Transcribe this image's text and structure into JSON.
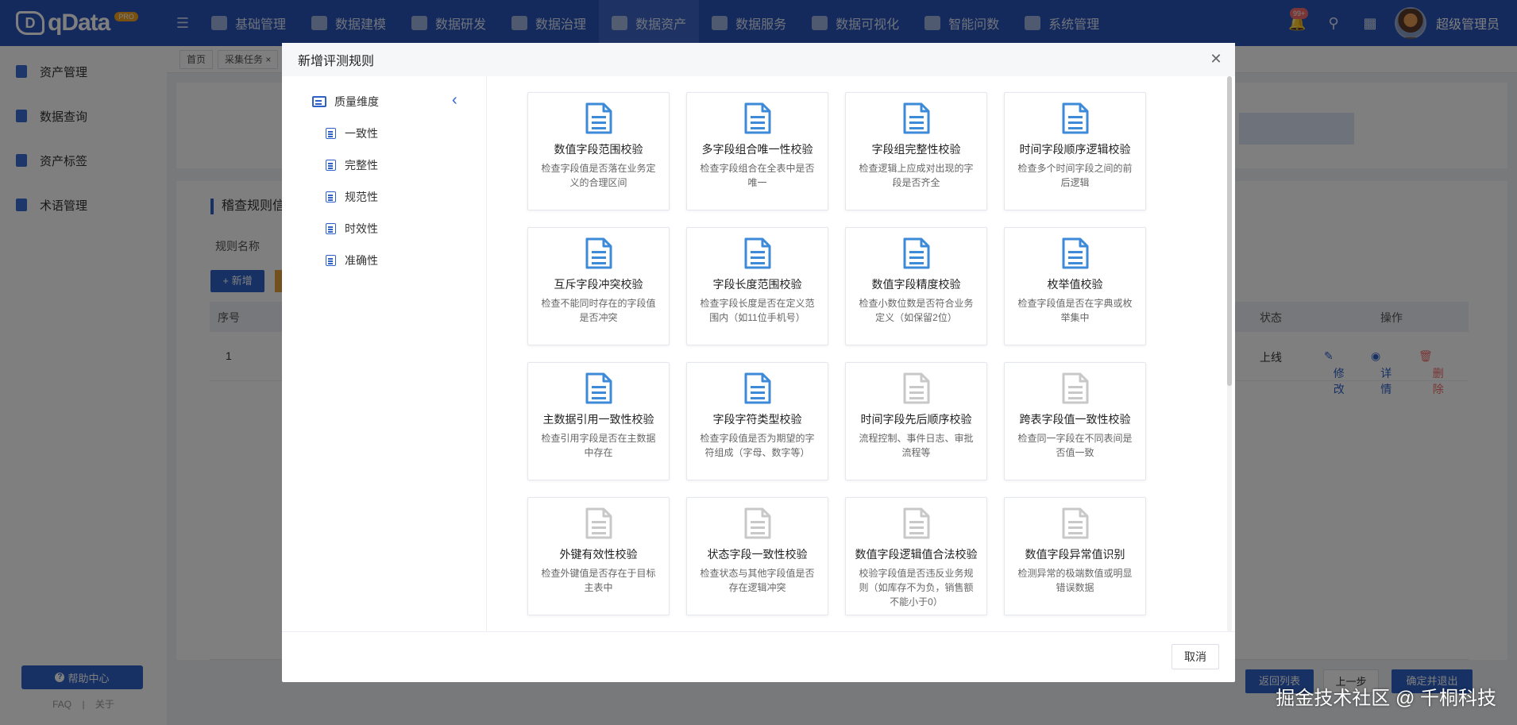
{
  "app": {
    "logo_text": "qData",
    "logo_mark": "D",
    "logo_badge": "PRO"
  },
  "topnav": {
    "items": [
      {
        "label": "基础管理"
      },
      {
        "label": "数据建模"
      },
      {
        "label": "数据研发"
      },
      {
        "label": "数据治理"
      },
      {
        "label": "数据资产",
        "active": true
      },
      {
        "label": "数据服务"
      },
      {
        "label": "数据可视化"
      },
      {
        "label": "智能问数"
      },
      {
        "label": "系统管理"
      }
    ],
    "message_badge": "99+",
    "username": "超级管理员"
  },
  "sidebar": {
    "items": [
      {
        "label": "资产管理"
      },
      {
        "label": "数据查询"
      },
      {
        "label": "资产标签"
      },
      {
        "label": "术语管理"
      }
    ],
    "help_label": "帮助中心",
    "footer_links": [
      "FAQ",
      "|",
      "关于"
    ]
  },
  "background": {
    "tabs": [
      "首页",
      "采集任务 ×"
    ],
    "section_title": "稽查规则信",
    "filter_label": "规则名称",
    "add_button": "+ 新增",
    "table_headers": [
      "序号",
      "状态",
      "操作"
    ],
    "row": {
      "index": "1",
      "status": "上线",
      "edit": "修改",
      "detail": "详情",
      "delete": "删除"
    },
    "buttons": [
      "返回列表",
      "上一步",
      "确定并退出"
    ]
  },
  "dialog": {
    "title": "新增评测规则",
    "tree": {
      "root": "质量维度",
      "children": [
        "一致性",
        "完整性",
        "规范性",
        "时效性",
        "准确性"
      ]
    },
    "cards": [
      {
        "title": "数值字段范围校验",
        "desc": "检查字段值是否落在业务定义的合理区间",
        "enabled": true
      },
      {
        "title": "多字段组合唯一性校验",
        "desc": "检查字段组合在全表中是否唯一",
        "enabled": true
      },
      {
        "title": "字段组完整性校验",
        "desc": "检查逻辑上应成对出现的字段是否齐全",
        "enabled": true
      },
      {
        "title": "时间字段顺序逻辑校验",
        "desc": "检查多个时间字段之间的前后逻辑",
        "enabled": true
      },
      {
        "title": "互斥字段冲突校验",
        "desc": "检查不能同时存在的字段值是否冲突",
        "enabled": true
      },
      {
        "title": "字段长度范围校验",
        "desc": "检查字段长度是否在定义范围内（如11位手机号）",
        "enabled": true
      },
      {
        "title": "数值字段精度校验",
        "desc": "检查小数位数是否符合业务定义（如保留2位）",
        "enabled": true
      },
      {
        "title": "枚举值校验",
        "desc": "检查字段值是否在字典或枚举集中",
        "enabled": true
      },
      {
        "title": "主数据引用一致性校验",
        "desc": "检查引用字段是否在主数据中存在",
        "enabled": true
      },
      {
        "title": "字段字符类型校验",
        "desc": "检查字段值是否为期望的字符组成（字母、数字等）",
        "enabled": true
      },
      {
        "title": "时间字段先后顺序校验",
        "desc": "流程控制、事件日志、审批流程等",
        "enabled": false
      },
      {
        "title": "跨表字段值一致性校验",
        "desc": "检查同一字段在不同表间是否值一致",
        "enabled": false
      },
      {
        "title": "外键有效性校验",
        "desc": "检查外键值是否存在于目标主表中",
        "enabled": false
      },
      {
        "title": "状态字段一致性校验",
        "desc": "检查状态与其他字段值是否存在逻辑冲突",
        "enabled": false
      },
      {
        "title": "数值字段逻辑值合法校验",
        "desc": "校验字段值是否违反业务规则（如库存不为负，销售额不能小于0）",
        "enabled": false
      },
      {
        "title": "数值字段异常值识别",
        "desc": "检测异常的极端数值或明显错误数据",
        "enabled": false
      }
    ],
    "cancel_label": "取消"
  },
  "watermark": "掘金技术社区 @ 千桐科技",
  "colors": {
    "primary": "#2b54b8",
    "accent": "#2f62c8",
    "icon_enabled": "#3d8ad8",
    "icon_disabled": "#c8c8c8"
  }
}
